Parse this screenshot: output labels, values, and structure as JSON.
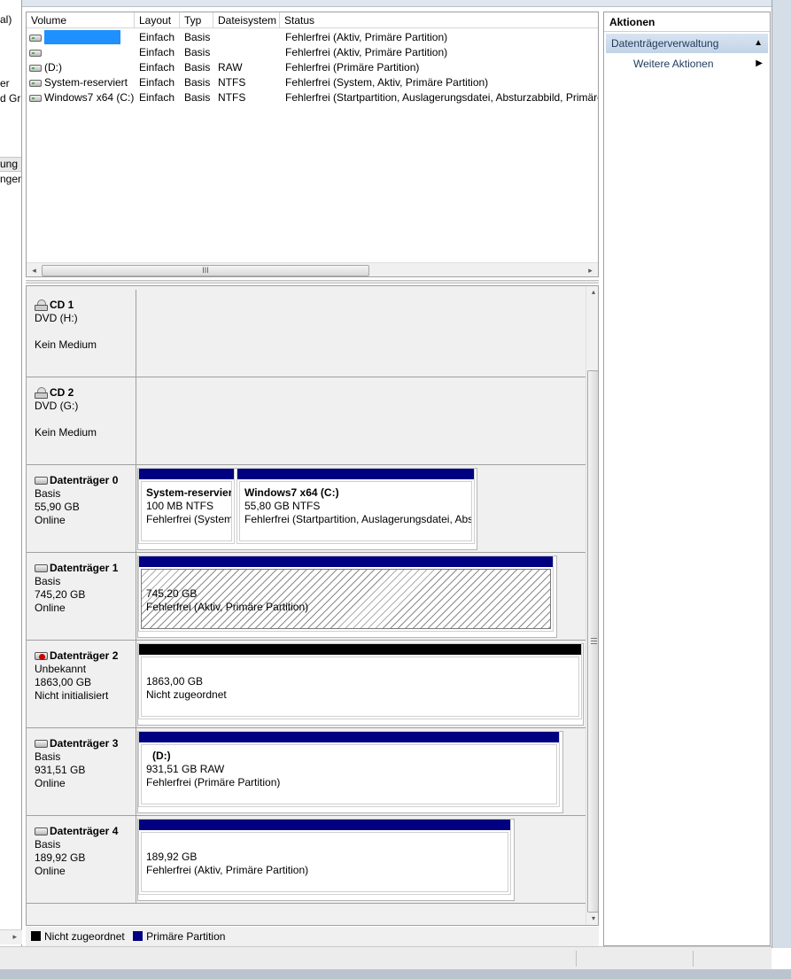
{
  "left_tree": {
    "fragments": [
      "al)",
      "er",
      "d Gr",
      "ung",
      "ngen"
    ]
  },
  "volume_list": {
    "columns": [
      "Volume",
      "Layout",
      "Typ",
      "Dateisystem",
      "Status"
    ],
    "rows": [
      {
        "volume": "",
        "layout": "Einfach",
        "typ": "Basis",
        "dateisystem": "",
        "status": "Fehlerfrei (Aktiv, Primäre Partition)",
        "redacted": true
      },
      {
        "volume": "",
        "layout": "Einfach",
        "typ": "Basis",
        "dateisystem": "",
        "status": "Fehlerfrei (Aktiv, Primäre Partition)",
        "redacted": false
      },
      {
        "volume": "(D:)",
        "layout": "Einfach",
        "typ": "Basis",
        "dateisystem": "RAW",
        "status": "Fehlerfrei (Primäre Partition)",
        "redacted": false
      },
      {
        "volume": "System-reserviert",
        "layout": "Einfach",
        "typ": "Basis",
        "dateisystem": "NTFS",
        "status": "Fehlerfrei (System, Aktiv, Primäre Partition)",
        "redacted": false
      },
      {
        "volume": "Windows7 x64 (C:)",
        "layout": "Einfach",
        "typ": "Basis",
        "dateisystem": "NTFS",
        "status": "Fehlerfrei (Startpartition, Auslagerungsdatei, Absturzabbild, Primäre",
        "redacted": false
      }
    ],
    "hscroll_grip": "III"
  },
  "disks": [
    {
      "name": "CD 1",
      "line1": "DVD (H:)",
      "line2": "",
      "line3": "Kein Medium",
      "icon": "cd-icon"
    },
    {
      "name": "CD 2",
      "line1": "DVD (G:)",
      "line2": "",
      "line3": "Kein Medium",
      "icon": "cd-icon"
    },
    {
      "name": "Datenträger 0",
      "line1": "Basis",
      "line2": "55,90 GB",
      "line3": "Online",
      "icon": "disk-icon",
      "partitions": [
        {
          "title": "System-reservier",
          "size": "100 MB NTFS",
          "status": "Fehlerfrei (System,"
        },
        {
          "title": "Windows7 x64  (C:)",
          "size": "55,80 GB NTFS",
          "status": "Fehlerfrei (Startpartition, Auslagerungsdatei, Abs"
        }
      ]
    },
    {
      "name": "Datenträger 1",
      "line1": "Basis",
      "line2": "745,20 GB",
      "line3": "Online",
      "icon": "disk-icon",
      "partitions": [
        {
          "title": "",
          "size": "745,20 GB",
          "status": "Fehlerfrei (Aktiv, Primäre Partition)"
        }
      ]
    },
    {
      "name": "Datenträger 2",
      "line1": "Unbekannt",
      "line2": "1863,00 GB",
      "line3": "Nicht initialisiert",
      "icon": "disk-warning-icon",
      "partitions": [
        {
          "title": "",
          "size": "1863,00 GB",
          "status": "Nicht zugeordnet"
        }
      ]
    },
    {
      "name": "Datenträger 3",
      "line1": "Basis",
      "line2": "931,51 GB",
      "line3": "Online",
      "icon": "disk-icon",
      "partitions": [
        {
          "title": "(D:)",
          "size": "931,51 GB RAW",
          "status": "Fehlerfrei (Primäre Partition)"
        }
      ]
    },
    {
      "name": "Datenträger 4",
      "line1": "Basis",
      "line2": "189,92 GB",
      "line3": "Online",
      "icon": "disk-icon",
      "partitions": [
        {
          "title": "",
          "size": "189,92 GB",
          "status": "Fehlerfrei (Aktiv, Primäre Partition)"
        }
      ]
    }
  ],
  "legend": {
    "unallocated": {
      "label": "Nicht zugeordnet",
      "color": "#000000"
    },
    "primary": {
      "label": "Primäre Partition",
      "color": "#000080"
    }
  },
  "actions": {
    "title": "Aktionen",
    "section": "Datenträgerverwaltung",
    "more": "Weitere Aktionen"
  },
  "colors": {
    "primary_partition": "#000080",
    "unallocated": "#000000",
    "section_header": "#c2d3e8"
  }
}
